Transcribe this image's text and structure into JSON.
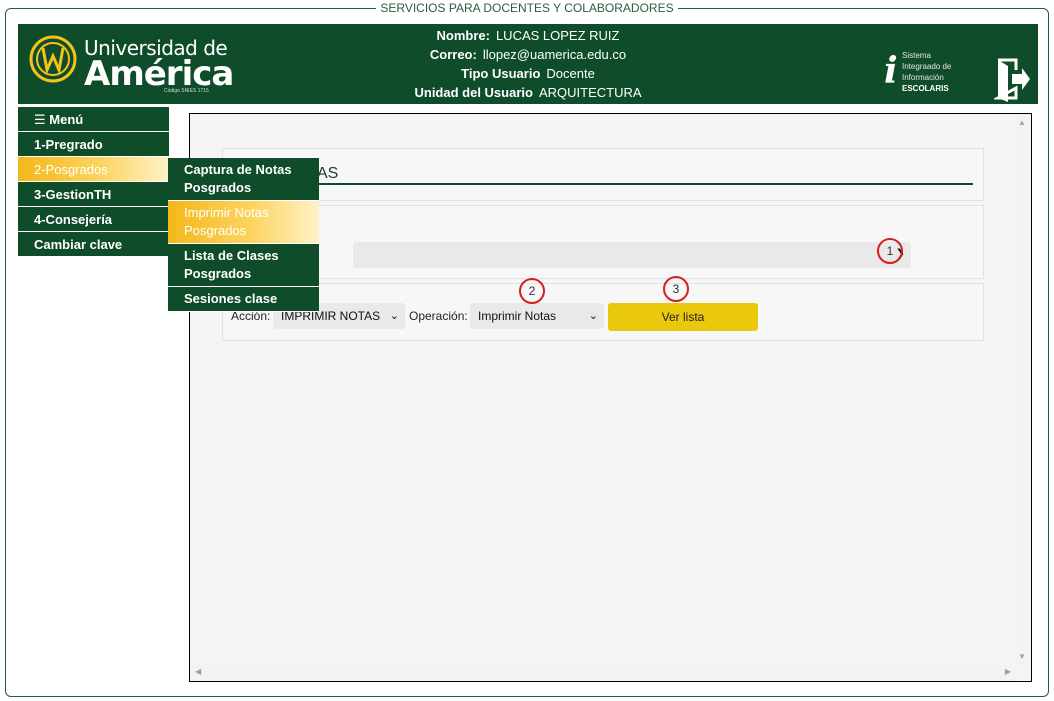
{
  "frame": {
    "legend": "SERVICIOS PARA DOCENTES Y COLABORADORES"
  },
  "logo": {
    "line1": "Universidad de",
    "line2": "América",
    "code": "Código SNIES 1715"
  },
  "user": {
    "name_label": "Nombre:",
    "name": "LUCAS LOPEZ RUIZ",
    "email_label": "Correo:",
    "email": "llopez@uamerica.edu.co",
    "type_label": "Tipo Usuario",
    "type": "Docente",
    "unit_label": "Unidad del Usuario",
    "unit": "ARQUITECTURA"
  },
  "escolaris": {
    "line1": "Sistema",
    "line2": "Integraado de",
    "line3": "Información",
    "line4": "ESCOLARIS"
  },
  "menu": {
    "header": "☰ Menú",
    "items": [
      {
        "label": "1-Pregrado"
      },
      {
        "label": "2-Posgrados"
      },
      {
        "label": "3-GestionTH"
      },
      {
        "label": "4-Consejería"
      },
      {
        "label": "Cambiar clave"
      }
    ]
  },
  "submenu": {
    "items": [
      {
        "label": "Captura de Notas Posgrados"
      },
      {
        "label": "Imprimir Notas Posgrados"
      },
      {
        "label": "Lista de Clases Posgrados"
      },
      {
        "label": "Sesiones clase"
      }
    ]
  },
  "form": {
    "section_title_visible": "AS",
    "accion_label": "Acción:",
    "accion_value": "IMPRIMIR NOTAS",
    "operacion_label": "Operación:",
    "operacion_value": "Imprimir Notas",
    "button_label": "Ver lista"
  },
  "badges": {
    "one": "1",
    "two": "2",
    "three": "3"
  },
  "colors": {
    "brand_green": "#0f4c2a",
    "accent_yellow": "#e9c80e",
    "badge_red": "#d32020"
  }
}
